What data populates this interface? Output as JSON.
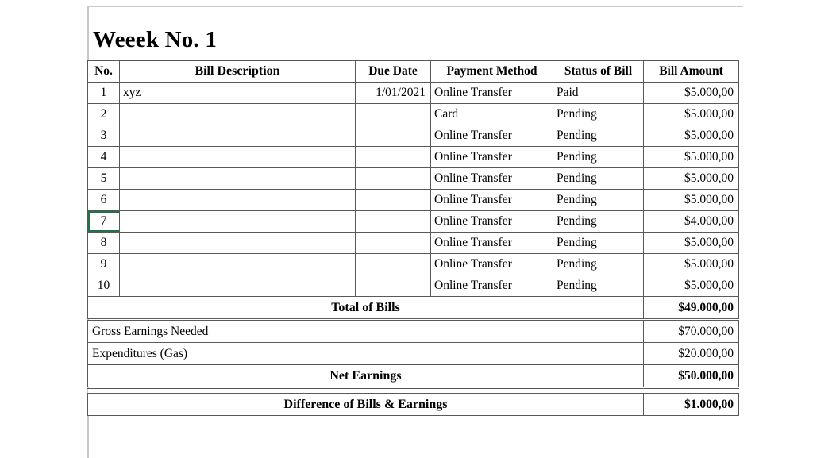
{
  "document": {
    "title": "Weeek No. 1"
  },
  "table": {
    "columns": [
      {
        "key": "no",
        "label": "No."
      },
      {
        "key": "desc",
        "label": "Bill Description"
      },
      {
        "key": "due",
        "label": "Due Date"
      },
      {
        "key": "pay",
        "label": "Payment Method"
      },
      {
        "key": "status",
        "label": "Status of Bill"
      },
      {
        "key": "amount",
        "label": "Bill Amount"
      }
    ],
    "rows": [
      {
        "no": "1",
        "desc": "xyz",
        "due": "1/01/2021",
        "pay": "Online Transfer",
        "status": "Paid",
        "amount": "$5.000,00",
        "selected": false
      },
      {
        "no": "2",
        "desc": "",
        "due": "",
        "pay": "Card",
        "status": "Pending",
        "amount": "$5.000,00",
        "selected": false
      },
      {
        "no": "3",
        "desc": "",
        "due": "",
        "pay": "Online Transfer",
        "status": "Pending",
        "amount": "$5.000,00",
        "selected": false
      },
      {
        "no": "4",
        "desc": "",
        "due": "",
        "pay": "Online Transfer",
        "status": "Pending",
        "amount": "$5.000,00",
        "selected": false
      },
      {
        "no": "5",
        "desc": "",
        "due": "",
        "pay": "Online Transfer",
        "status": "Pending",
        "amount": "$5.000,00",
        "selected": false
      },
      {
        "no": "6",
        "desc": "",
        "due": "",
        "pay": "Online Transfer",
        "status": "Pending",
        "amount": "$5.000,00",
        "selected": false
      },
      {
        "no": "7",
        "desc": "",
        "due": "",
        "pay": "Online Transfer",
        "status": "Pending",
        "amount": "$4.000,00",
        "selected": true
      },
      {
        "no": "8",
        "desc": "",
        "due": "",
        "pay": "Online Transfer",
        "status": "Pending",
        "amount": "$5.000,00",
        "selected": false
      },
      {
        "no": "9",
        "desc": "",
        "due": "",
        "pay": "Online Transfer",
        "status": "Pending",
        "amount": "$5.000,00",
        "selected": false
      },
      {
        "no": "10",
        "desc": "",
        "due": "",
        "pay": "Online Transfer",
        "status": "Pending",
        "amount": "$5.000,00",
        "selected": false
      }
    ],
    "summary": [
      {
        "label": "Total of Bills",
        "amount": "$49.000,00",
        "style": "bold-centered"
      },
      {
        "label": "Gross Earnings Needed",
        "amount": "$70.000,00",
        "style": "plain-left"
      },
      {
        "label": "Expenditures (Gas)",
        "amount": "$20.000,00",
        "style": "plain-left"
      },
      {
        "label": "Net Earnings",
        "amount": "$50.000,00",
        "style": "bold-centered"
      },
      {
        "label": "Difference of Bills & Earnings",
        "amount": "$1.000,00",
        "style": "bold-centered"
      }
    ]
  },
  "colors": {
    "header_fill": "#dce6f1",
    "grid_line": "#595959",
    "selection_green": "#217346",
    "page_rule": "#c8c8c8"
  }
}
